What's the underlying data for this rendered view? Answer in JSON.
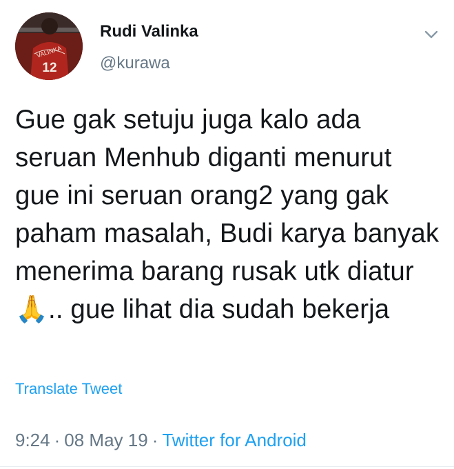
{
  "tweet": {
    "author_name": "Rudi Valinka",
    "author_handle": "@kurawa",
    "avatar_jersey_name": "VALINKA",
    "avatar_jersey_number": "12",
    "text": "Gue gak setuju juga kalo ada seruan Menhub diganti menurut gue ini seruan orang2 yang gak paham masalah, Budi karya banyak menerima barang rusak utk diatur 🙏.. gue lihat dia sudah bekerja",
    "translate_label": "Translate Tweet",
    "time": "9:24",
    "separator": "·",
    "date": "08 May 19",
    "source": "Twitter for Android"
  },
  "icons": {
    "menu": "chevron-down-icon"
  },
  "colors": {
    "link": "#1da1f2",
    "secondary_text": "#657786",
    "primary_text": "#14171a"
  }
}
